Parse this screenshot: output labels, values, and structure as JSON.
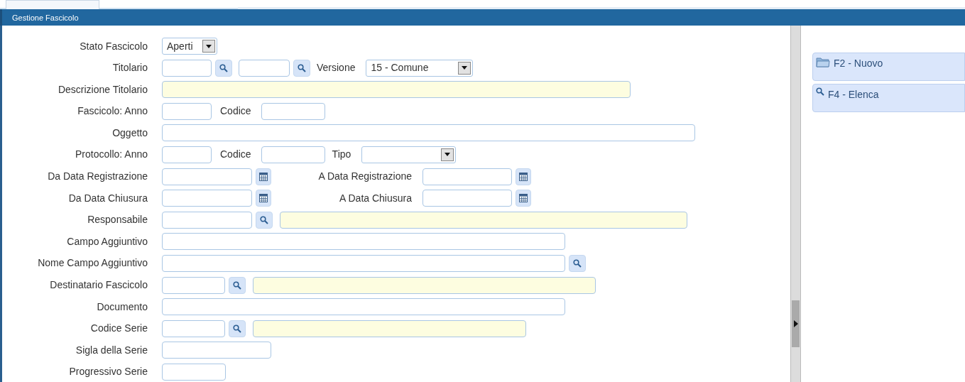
{
  "window": {
    "title": "Gestione Fascicolo"
  },
  "form": {
    "rows": [
      {
        "label": "Stato Fascicolo",
        "controls": [
          {
            "kind": "select",
            "value": "Aperti"
          }
        ]
      },
      {
        "label": "Titolario",
        "controls": [
          {
            "kind": "input"
          },
          {
            "kind": "lookup"
          },
          {
            "kind": "input"
          },
          {
            "kind": "lookup"
          },
          {
            "kind": "label",
            "text": "Versione"
          },
          {
            "kind": "select",
            "value": "15 - Comune"
          }
        ]
      },
      {
        "label": "Descrizione Titolario",
        "controls": [
          {
            "kind": "display"
          }
        ]
      },
      {
        "label": "Fascicolo: Anno",
        "controls": [
          {
            "kind": "input"
          },
          {
            "kind": "label",
            "text": "Codice"
          },
          {
            "kind": "input"
          }
        ]
      },
      {
        "label": "Oggetto",
        "controls": [
          {
            "kind": "input"
          }
        ]
      },
      {
        "label": "Protocollo: Anno",
        "controls": [
          {
            "kind": "input"
          },
          {
            "kind": "label",
            "text": "Codice"
          },
          {
            "kind": "input"
          },
          {
            "kind": "label",
            "text": "Tipo"
          },
          {
            "kind": "select"
          }
        ]
      },
      {
        "label": "Da Data Registrazione",
        "controls": [
          {
            "kind": "input"
          },
          {
            "kind": "calendar"
          },
          {
            "kind": "label",
            "text": "A Data Registrazione"
          },
          {
            "kind": "input"
          },
          {
            "kind": "calendar"
          }
        ]
      },
      {
        "label": "Da Data Chiusura",
        "controls": [
          {
            "kind": "input"
          },
          {
            "kind": "calendar"
          },
          {
            "kind": "label",
            "text": "A Data Chiusura"
          },
          {
            "kind": "input"
          },
          {
            "kind": "calendar"
          }
        ]
      },
      {
        "label": "Responsabile",
        "controls": [
          {
            "kind": "input"
          },
          {
            "kind": "lookup"
          },
          {
            "kind": "display"
          }
        ]
      },
      {
        "label": "Campo Aggiuntivo",
        "controls": [
          {
            "kind": "input"
          }
        ]
      },
      {
        "label": "Nome Campo Aggiuntivo",
        "controls": [
          {
            "kind": "input"
          },
          {
            "kind": "lookup"
          }
        ]
      },
      {
        "label": "Destinatario Fascicolo",
        "controls": [
          {
            "kind": "input"
          },
          {
            "kind": "lookup"
          },
          {
            "kind": "display"
          }
        ]
      },
      {
        "label": "Documento",
        "controls": [
          {
            "kind": "input"
          }
        ]
      },
      {
        "label": "Codice Serie",
        "controls": [
          {
            "kind": "input"
          },
          {
            "kind": "lookup"
          },
          {
            "kind": "display"
          }
        ]
      },
      {
        "label": "Sigla della Serie",
        "controls": [
          {
            "kind": "input"
          }
        ]
      },
      {
        "label": "Progressivo Serie",
        "controls": [
          {
            "kind": "input"
          }
        ]
      }
    ]
  },
  "actions": [
    {
      "label": "F2 - Nuovo"
    },
    {
      "label": "F4 - Elenca"
    }
  ]
}
